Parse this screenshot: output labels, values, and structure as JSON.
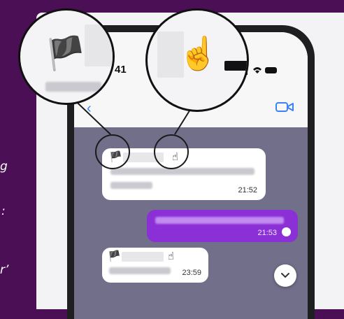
{
  "side_text": [
    "g",
    ":",
    "r’"
  ],
  "status_bar": {
    "time": "41",
    "icons": [
      "signal-icon",
      "wifi-icon",
      "battery-icon"
    ]
  },
  "header": {
    "icons": [
      "back-chevron-icon",
      "video-call-icon"
    ]
  },
  "messages": [
    {
      "direction": "incoming",
      "sender_flag_icon": "black-flag-emoji",
      "reaction_icon": "pointing-up-emoji",
      "time": "21:52"
    },
    {
      "direction": "outgoing",
      "time": "21:53",
      "status_icon": "read-check-icon"
    },
    {
      "direction": "incoming",
      "sender_flag_icon": "black-flag-emoji",
      "reaction_icon": "pointing-up-emoji",
      "time": "23:59"
    }
  ],
  "magnifiers": {
    "left": {
      "emoji": "🏴",
      "icon": "black-flag-emoji"
    },
    "right": {
      "emoji": "☝️",
      "icon": "pointing-up-emoji"
    }
  },
  "inline_emoji": {
    "flag": "🏴",
    "point": "☝"
  },
  "colors": {
    "background": "#4a0f55",
    "chat_bg": "#716f89",
    "outgoing_bubble": "#8b2fd6",
    "accent_blue": "#3b82f6"
  },
  "controls": {
    "scroll_down_icon": "chevron-down-icon"
  }
}
